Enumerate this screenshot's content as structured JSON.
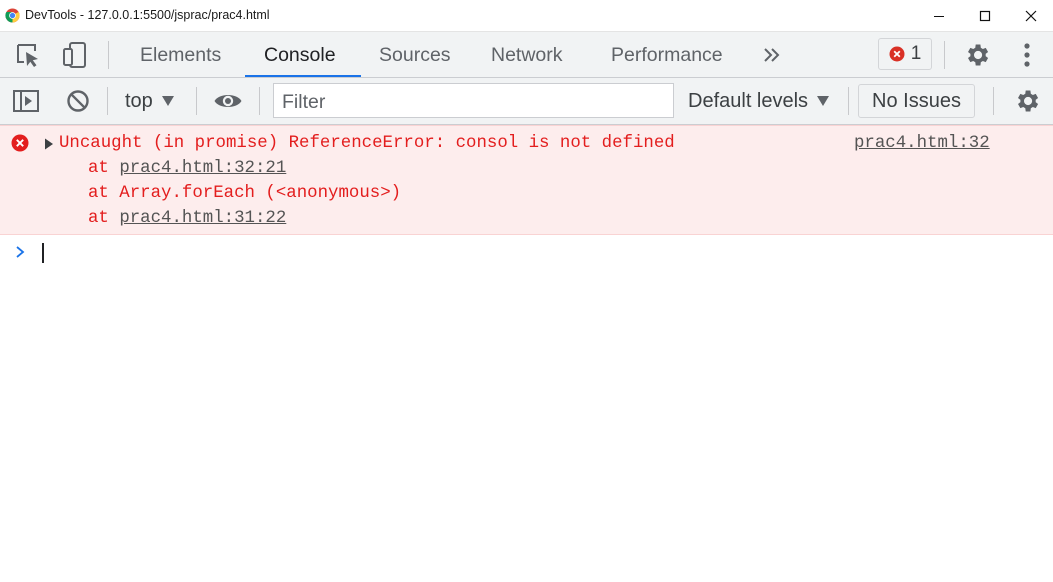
{
  "window": {
    "title": "DevTools - 127.0.0.1:5500/jsprac/prac4.html",
    "controls": [
      "minimize-icon",
      "maximize-icon",
      "close-icon"
    ]
  },
  "tabs": {
    "items": [
      {
        "label": "Elements"
      },
      {
        "label": "Console",
        "active": true
      },
      {
        "label": "Sources"
      },
      {
        "label": "Network"
      },
      {
        "label": "Performance"
      }
    ],
    "more_icon": "double-chevron-right-icon",
    "error_count": "1",
    "accent_color": "#1a73e8"
  },
  "toolbar": {
    "context": "top",
    "filter_placeholder": "Filter",
    "filter_value": "",
    "levels": "Default levels",
    "issues": "No Issues"
  },
  "console": {
    "error": {
      "message": "Uncaught (in promise) ReferenceError: consol is not defined",
      "source": "prac4.html:32",
      "stack": [
        {
          "prefix": "at ",
          "location": "prac4.html:32:21",
          "is_link": true
        },
        {
          "prefix": "at Array.forEach (<anonymous>)",
          "location": "",
          "is_link": false
        },
        {
          "prefix": "at ",
          "location": "prac4.html:31:22",
          "is_link": true
        }
      ],
      "text_color": "#e31e1e",
      "background": "#fdeded"
    },
    "prompt_value": ""
  }
}
